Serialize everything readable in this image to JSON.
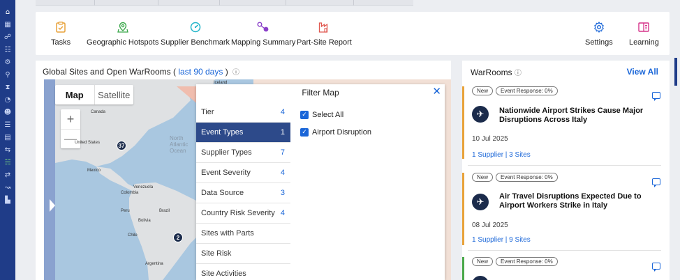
{
  "rail_icons": [
    "home-icon",
    "calendar-icon",
    "hierarchy-icon",
    "users-group-icon",
    "gear-small-icon",
    "search-person-icon",
    "hourglass-icon",
    "gauge-icon",
    "people-icon",
    "list-icon",
    "document-icon",
    "swap-icon",
    "network-icon",
    "arrows-icon",
    "routing-icon",
    "factory-icon"
  ],
  "toolbar": {
    "tasks": "Tasks",
    "hotspots": "Geographic Hotspots",
    "benchmark": "Supplier Benchmark",
    "mapping": "Mapping Summary",
    "partsite": "Part-Site Report",
    "settings": "Settings",
    "learning": "Learning"
  },
  "map": {
    "title_prefix": "Global Sites and Open WarRooms (",
    "title_link": "last 90 days",
    "title_suffix": ")",
    "map_btn": "Map",
    "satellite_btn": "Satellite",
    "zoom_in": "+",
    "zoom_out": "—",
    "labels": {
      "canada": "Canada",
      "us": "United States",
      "mexico": "Mexico",
      "venezuela": "Venezuela",
      "colombia": "Colombia",
      "peru": "Peru",
      "brazil": "Brazil",
      "bolivia": "Bolivia",
      "chile": "Chile",
      "argentina": "Argentina",
      "iceland": "Iceland",
      "atlantic": "North Atlantic Ocean"
    },
    "clusters": {
      "us": "37",
      "brazil": "2"
    }
  },
  "filter": {
    "title": "Filter Map",
    "close": "✕",
    "items": [
      {
        "label": "Tier",
        "count": "4"
      },
      {
        "label": "Event Types",
        "count": "1"
      },
      {
        "label": "Supplier Types",
        "count": "7"
      },
      {
        "label": "Event Severity",
        "count": "4"
      },
      {
        "label": "Data Source",
        "count": "3"
      },
      {
        "label": "Country Risk Severity",
        "count": "4"
      },
      {
        "label": "Sites with Parts",
        "count": ""
      },
      {
        "label": "Site Risk",
        "count": ""
      },
      {
        "label": "Site Activities",
        "count": ""
      }
    ],
    "options": [
      {
        "label": "Select All",
        "checked": true
      },
      {
        "label": "Airport Disruption",
        "checked": true
      }
    ]
  },
  "warrooms": {
    "title": "WarRooms",
    "view_all": "View All",
    "cards": [
      {
        "badge_new": "New",
        "badge_response": "Event Response: 0%",
        "title": "Nationwide Airport Strikes Cause Major Disruptions Across Italy",
        "date": "10 Jul 2025",
        "links": "1 Supplier | 3 Sites",
        "accent": "#e8a23a"
      },
      {
        "badge_new": "New",
        "badge_response": "Event Response: 0%",
        "title": "Air Travel Disruptions Expected Due to Airport Workers Strike in Italy",
        "date": "08 Jul 2025",
        "links": "1 Supplier | 9 Sites",
        "accent": "#e8a23a"
      },
      {
        "badge_new": "New",
        "badge_response": "Event Response: 0%",
        "title": "",
        "date": "",
        "links": "",
        "accent": "#4aa84a"
      }
    ]
  },
  "colors": {
    "rail": "#1f3c88",
    "link": "#1a66d8",
    "active_filter": "#2d4a8a"
  }
}
